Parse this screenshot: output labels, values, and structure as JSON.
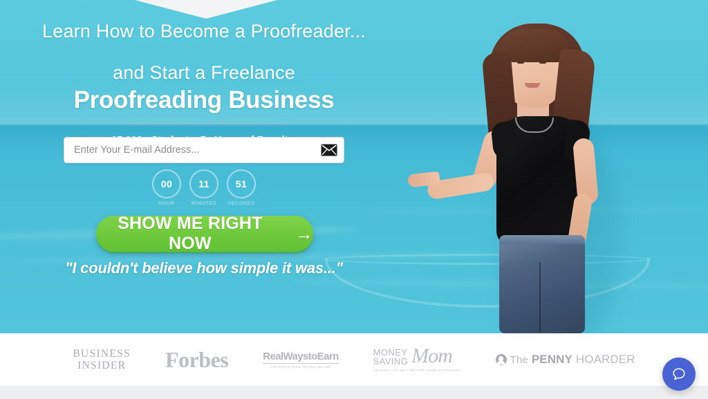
{
  "hero": {
    "headline_line1": "Learn How to Become a Proofreader...",
    "headline_line2": "and Start a Freelance",
    "headline_emphasis": "Proofreading Business",
    "obscured_subline": "..............................................................................",
    "stats": "15,000+ Students. 7+ Years of Results.",
    "quote": "\"I couldn't believe how simple it was...\"",
    "sky_color": "#55c8dd",
    "water_color": "#45bad6"
  },
  "form": {
    "email_placeholder": "Enter Your E-mail Address...",
    "email_value": "",
    "submit_icon": "envelope-icon"
  },
  "countdown": {
    "units": [
      {
        "value": "00",
        "label": "HOUR"
      },
      {
        "value": "11",
        "label": "MINUTES"
      },
      {
        "value": "51",
        "label": "SECONDS"
      }
    ]
  },
  "cta": {
    "label": "SHOW ME RIGHT NOW",
    "arrow": "→",
    "color": "#6ec93c"
  },
  "press": {
    "logos": [
      {
        "id": "business-insider",
        "line1": "BUSINESS",
        "line2": "INSIDER"
      },
      {
        "id": "forbes",
        "text": "Forbes"
      },
      {
        "id": "real-ways-to-earn",
        "text": "RealWaystoEarn",
        "tagline": "real work at home info you can use!"
      },
      {
        "id": "money-saving-mom",
        "line1": "MONEY",
        "line2": "SAVING",
        "script": "Mom",
        "tagline": "HELPING YOU BE A BETTER HOME ECONOMIST"
      },
      {
        "id": "the-penny-hoarder",
        "the": "The",
        "strong": "PENNY",
        "light": "HOARDER"
      }
    ]
  },
  "chat": {
    "icon": "chat-bubble-icon",
    "color": "#4a63d4"
  }
}
